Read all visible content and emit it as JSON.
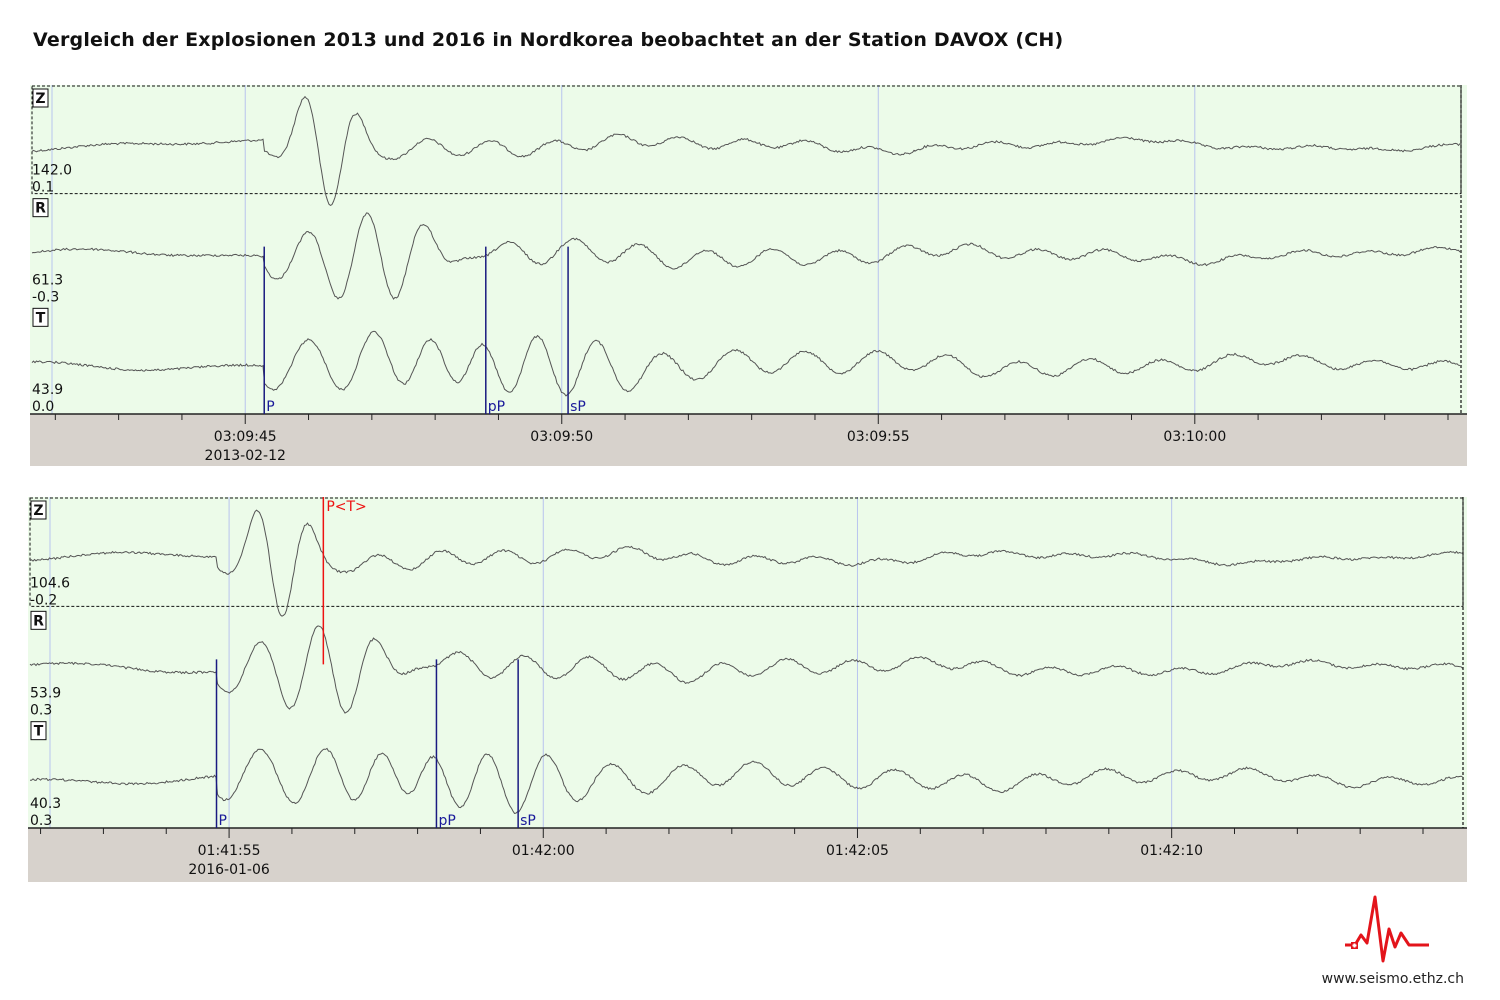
{
  "page": {
    "title": "Vergleich der Explosionen 2013 und 2016 in Nordkorea beobachtet an der Station DAVOX (CH)",
    "site": "www.seismo.ethz.ch",
    "logo_icon": "seismogram-logo-icon"
  },
  "colors": {
    "trace_bg": "#ecfbe9",
    "axis_bg": "#d7d2cc",
    "trace": "#555555",
    "pick": "#1a1a80",
    "pick_label": "#1a1a9a",
    "theoretical_pick": "#ee1111",
    "gridline": "#b8c4ee",
    "logo": "#e3141b"
  },
  "chart_data": [
    {
      "type": "line",
      "event": "2013",
      "date_label": "2013-02-12",
      "x_range": [
        "03:09:41.6",
        "03:10:04.3"
      ],
      "x_ticks": [
        "03:09:45",
        "03:09:50",
        "03:09:55",
        "03:10:00"
      ],
      "grid": true,
      "components": [
        {
          "name": "Z",
          "amplitude": "142.0",
          "offset": "0.1",
          "selected": true
        },
        {
          "name": "R",
          "amplitude": "61.3",
          "offset": "-0.3"
        },
        {
          "name": "T",
          "amplitude": "43.9",
          "offset": "0.0"
        }
      ],
      "picks": [
        {
          "label": "P",
          "time": "03:09:45.3"
        },
        {
          "label": "pP",
          "time": "03:09:48.8"
        },
        {
          "label": "sP",
          "time": "03:09:50.1"
        }
      ]
    },
    {
      "type": "line",
      "event": "2016",
      "date_label": "2016-01-06",
      "x_range": [
        "01:41:51.8",
        "01:42:14.7"
      ],
      "x_ticks": [
        "01:41:55",
        "01:42:00",
        "01:42:05",
        "01:42:10"
      ],
      "grid": true,
      "components": [
        {
          "name": "Z",
          "amplitude": "104.6",
          "offset": "-0.2",
          "selected": true
        },
        {
          "name": "R",
          "amplitude": "53.9",
          "offset": "0.3"
        },
        {
          "name": "T",
          "amplitude": "40.3",
          "offset": "0.3"
        }
      ],
      "picks": [
        {
          "label": "P",
          "time": "01:41:54.8"
        },
        {
          "label": "pP",
          "time": "01:41:58.3"
        },
        {
          "label": "sP",
          "time": "01:41:59.6"
        }
      ],
      "theoretical_picks": [
        {
          "label": "P<T>",
          "time": "01:41:56.5"
        }
      ]
    }
  ]
}
